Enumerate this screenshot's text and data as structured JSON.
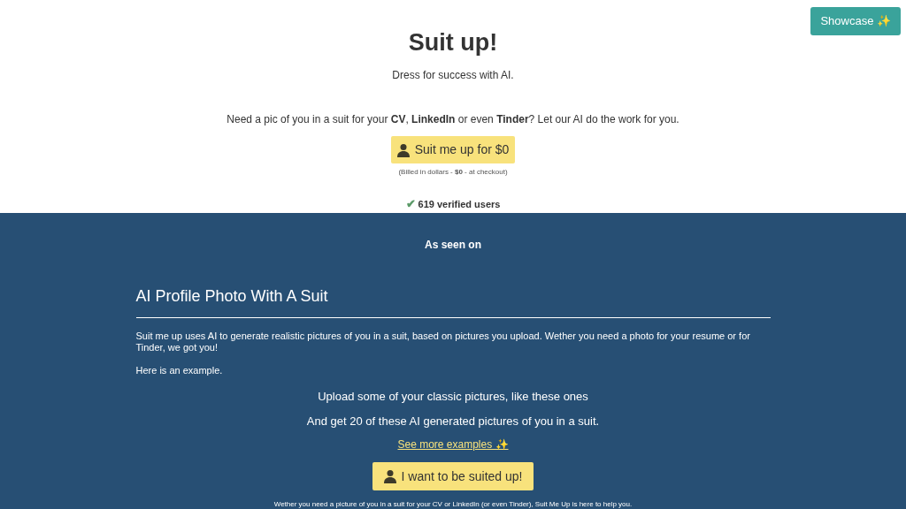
{
  "showcase_button": "Showcase ✨",
  "hero": {
    "title": "Suit up!",
    "subtitle": "Dress for success with AI.",
    "pitch": "Need a pic of you in a suit for your **CV**, **LinkedIn** or even **Tinder**? Let our AI do the work for you.",
    "cta": "Suit me up for $0",
    "billing_note": "(Billed in dollars - **$0** - at checkout)",
    "check": "✔",
    "users": "619 verified users"
  },
  "as_seen_on": "As seen on",
  "article": {
    "heading": "AI Profile Photo With A Suit",
    "paragraphs": [
      "Suit me up uses AI to generate realistic pictures of you in a suit, based on pictures you upload. Wether you need a photo for your resume or for Tinder, we got you!",
      "Here is an example."
    ],
    "upload_line": "Upload some of your classic pictures, like these ones",
    "result_line": "And get 20 of these AI generated pictures of you in a suit.",
    "examples_link": "See more examples ✨",
    "cta": "I want to be suited up!",
    "footer_note": "Wether you need a picture of you in a suit for your CV or LinkedIn (or even Tinder), Suit Me Up is here to help you."
  }
}
